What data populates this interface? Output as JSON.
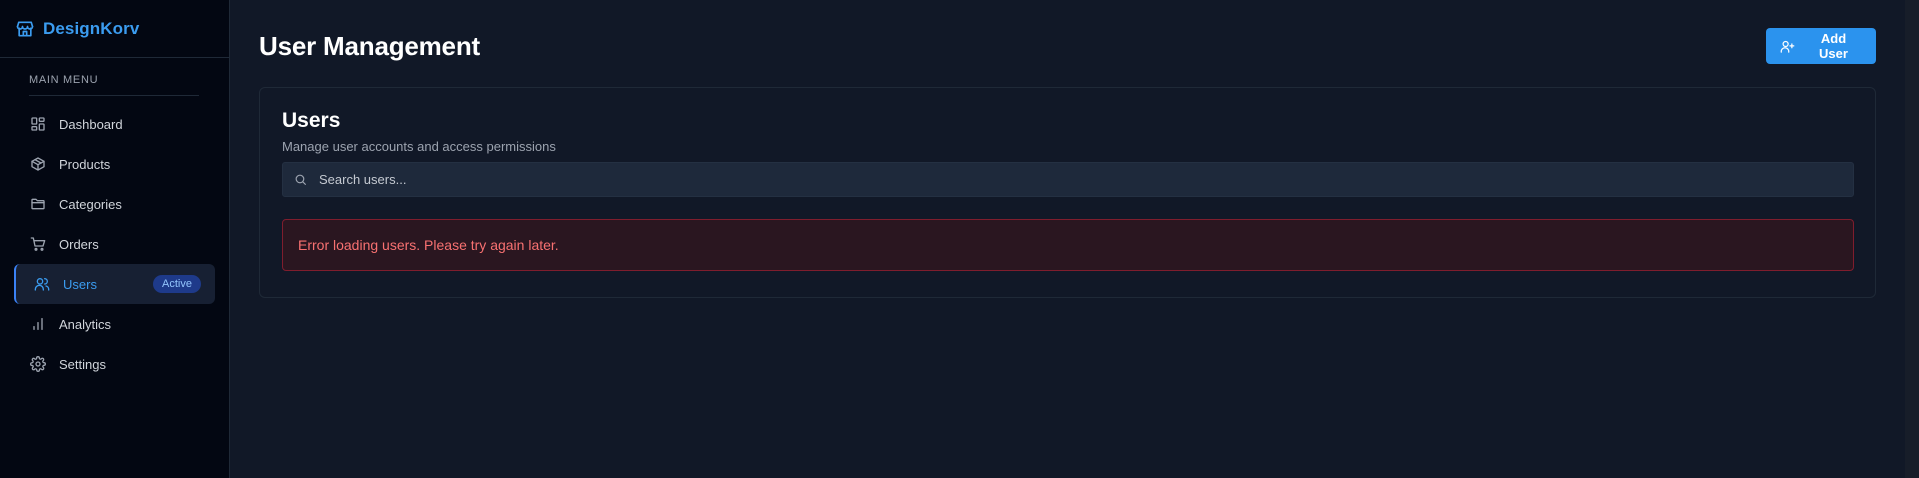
{
  "brand": {
    "name": "DesignKorv",
    "icon": "store-icon",
    "color": "#3b9cf0"
  },
  "sidebar": {
    "section_label": "MAIN MENU",
    "items": [
      {
        "label": "Dashboard",
        "icon": "dashboard-icon"
      },
      {
        "label": "Products",
        "icon": "package-icon"
      },
      {
        "label": "Categories",
        "icon": "folder-icon"
      },
      {
        "label": "Orders",
        "icon": "cart-icon"
      },
      {
        "label": "Users",
        "icon": "users-icon",
        "active": true,
        "badge": "Active"
      },
      {
        "label": "Analytics",
        "icon": "bar-chart-icon"
      },
      {
        "label": "Settings",
        "icon": "gear-icon"
      }
    ]
  },
  "header": {
    "title": "User Management",
    "add_button_label": "Add User",
    "add_button_icon": "user-plus-icon"
  },
  "users_card": {
    "title": "Users",
    "subtitle": "Manage user accounts and access permissions",
    "search_placeholder": "Search users...",
    "search_value": "",
    "error_message": "Error loading users. Please try again later."
  },
  "colors": {
    "accent": "#2b93ee",
    "error_text": "#f87171",
    "error_border": "#7f1d2d",
    "background": "#111827",
    "sidebar_background": "#030712"
  }
}
